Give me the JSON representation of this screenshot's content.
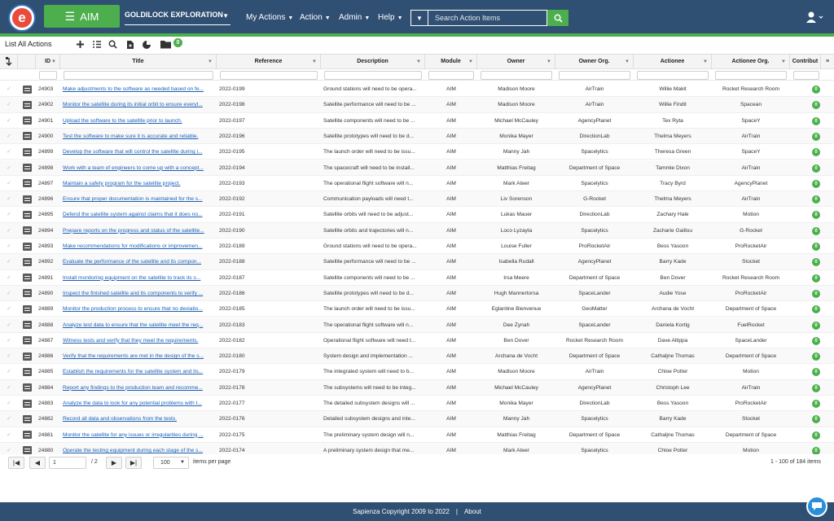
{
  "header": {
    "logo_letter": "e",
    "app_button": "AIM",
    "project": "GOLDILOCK EXPLORATION",
    "nav": [
      "My Actions",
      "Action",
      "Admin",
      "Help"
    ],
    "search_placeholder": "Search Action Items"
  },
  "toolbar": {
    "title": "List All Actions",
    "folder_badge": "0"
  },
  "columns": [
    "ID",
    "Title",
    "Reference",
    "Description",
    "Module",
    "Owner",
    "Owner Org.",
    "Actionee",
    "Actionee Org.",
    "Contribut"
  ],
  "rows": [
    {
      "id": "24903",
      "title": "Make adjustments to the software as needed based on fe...",
      "ref": "2022-0199",
      "desc": "Ground stations will need to be opera...",
      "module": "AIM",
      "owner": "Madison Moore",
      "owner_org": "AirTrain",
      "actionee": "Willie Makit",
      "actionee_org": "Rocket Research Room",
      "count": "0"
    },
    {
      "id": "24902",
      "title": "Monitor the satellite during its initial orbit to ensure everyt...",
      "ref": "2022-0198",
      "desc": "Satellite performance will need to be ...",
      "module": "AIM",
      "owner": "Madison Moore",
      "owner_org": "AirTrain",
      "actionee": "Willie Findit",
      "actionee_org": "Spacean",
      "count": "0"
    },
    {
      "id": "24901",
      "title": "Upload the software to the satellite prior to launch.",
      "ref": "2022-0197",
      "desc": "Satellite components will need to be ...",
      "module": "AIM",
      "owner": "Michael McCauley",
      "owner_org": "AgencyPlanet",
      "actionee": "Tex Ryta",
      "actionee_org": "SpaceY",
      "count": "0"
    },
    {
      "id": "24900",
      "title": "Test the software to make sure it is accurate and reliable.",
      "ref": "2022-0196",
      "desc": "Satellite prototypes will need to be d...",
      "module": "AIM",
      "owner": "Monika Mayer",
      "owner_org": "DirectionLab",
      "actionee": "Thelma Meyers",
      "actionee_org": "AirTrain",
      "count": "0"
    },
    {
      "id": "24899",
      "title": "Develop the software that will control the satellite during i...",
      "ref": "2022-0195",
      "desc": "The launch order will need to be issu...",
      "module": "AIM",
      "owner": "Manny Jah",
      "owner_org": "Spacelytics",
      "actionee": "Theresa Green",
      "actionee_org": "SpaceY",
      "count": "0"
    },
    {
      "id": "24898",
      "title": "Work with a team of engineers to come up with a concept...",
      "ref": "2022-0194",
      "desc": "The spacecraft will need to be install...",
      "module": "AIM",
      "owner": "Matthias Freitag",
      "owner_org": "Department of Space",
      "actionee": "Tammie Dixon",
      "actionee_org": "AirTrain",
      "count": "0"
    },
    {
      "id": "24897",
      "title": "Maintain a safety program for the satellite project.",
      "ref": "2022-0193",
      "desc": "The operational flight software will n...",
      "module": "AIM",
      "owner": "Mark Ateer",
      "owner_org": "Spacelytics",
      "actionee": "Tracy Byrd",
      "actionee_org": "AgencyPlanet",
      "count": "0"
    },
    {
      "id": "24896",
      "title": "Ensure that proper documentation is maintained for the s...",
      "ref": "2022-0192",
      "desc": "Communication payloads will need t...",
      "module": "AIM",
      "owner": "Liv Sorenson",
      "owner_org": "G-Rocket",
      "actionee": "Thelma Meyers",
      "actionee_org": "AirTrain",
      "count": "0"
    },
    {
      "id": "24895",
      "title": "Defend the satellite system against claims that it does no...",
      "ref": "2022-0191",
      "desc": "Satellite orbits will need to be adjust...",
      "module": "AIM",
      "owner": "Lukas Mauer",
      "owner_org": "DirectionLab",
      "actionee": "Zachary Hale",
      "actionee_org": "Motion",
      "count": "0"
    },
    {
      "id": "24894",
      "title": "Prepare reports on the progress and status of the satellite...",
      "ref": "2022-0190",
      "desc": "Satellite orbits and trajectories will n...",
      "module": "AIM",
      "owner": "Loco Lyzayta",
      "owner_org": "Spacelytics",
      "actionee": "Zacharie Gaillou",
      "actionee_org": "G-Rocket",
      "count": "0"
    },
    {
      "id": "24893",
      "title": "Make recommendations for modifications or improvemen...",
      "ref": "2022-0189",
      "desc": "Ground stations will need to be opera...",
      "module": "AIM",
      "owner": "Louise Fuller",
      "owner_org": "ProRocketAir",
      "actionee": "Bess Yasoon",
      "actionee_org": "ProRocketAir",
      "count": "0"
    },
    {
      "id": "24892",
      "title": "Evaluate the performance of the satellite and its compon...",
      "ref": "2022-0188",
      "desc": "Satellite performance will need to be ...",
      "module": "AIM",
      "owner": "Isabella Rudall",
      "owner_org": "AgencyPlanet",
      "actionee": "Barry Kade",
      "actionee_org": "Stocket",
      "count": "0"
    },
    {
      "id": "24891",
      "title": "Install monitoring equipment on the satellite to track its s...",
      "ref": "2022-0187",
      "desc": "Satellite components will need to be ...",
      "module": "AIM",
      "owner": "Irsa Meere",
      "owner_org": "Department of Space",
      "actionee": "Ben Dover",
      "actionee_org": "Rocket Research Room",
      "count": "0"
    },
    {
      "id": "24890",
      "title": "Inspect the finished satellite and its components to verify ...",
      "ref": "2022-0186",
      "desc": "Satellite prototypes will need to be d...",
      "module": "AIM",
      "owner": "Hugh Mannertorsa",
      "owner_org": "SpaceLander",
      "actionee": "Audie Yose",
      "actionee_org": "ProRocketAir",
      "count": "0"
    },
    {
      "id": "24889",
      "title": "Monitor the production process to ensure that no deviatio...",
      "ref": "2022-0185",
      "desc": "The launch order will need to be issu...",
      "module": "AIM",
      "owner": "Eglantine Bienvenue",
      "owner_org": "GeoMatter",
      "actionee": "Archana de Vocht",
      "actionee_org": "Department of Space",
      "count": "0"
    },
    {
      "id": "24888",
      "title": "Analyze test data to ensure that the satellite meet the req...",
      "ref": "2022-0183",
      "desc": "The operational flight software will n...",
      "module": "AIM",
      "owner": "Dee Zynah",
      "owner_org": "SpaceLander",
      "actionee": "Daniela Kortig",
      "actionee_org": "FuelRocket",
      "count": "0"
    },
    {
      "id": "24887",
      "title": "Witness tests and verify that they meet the requirements.",
      "ref": "2022-0182",
      "desc": "Operational flight software will need t...",
      "module": "AIM",
      "owner": "Ben Dover",
      "owner_org": "Rocket Research Room",
      "actionee": "Dave Allippa",
      "actionee_org": "SpaceLander",
      "count": "0"
    },
    {
      "id": "24886",
      "title": "Verify that the requirements are met in the design of the s...",
      "ref": "2022-0180",
      "desc": "System design and implementation ...",
      "module": "AIM",
      "owner": "Archana de Vocht",
      "owner_org": "Department of Space",
      "actionee": "Cathaljne Thomas",
      "actionee_org": "Department of Space",
      "count": "0"
    },
    {
      "id": "24885",
      "title": "Establish the requirements for the satellite system and its...",
      "ref": "2022-0179",
      "desc": "The integrated system will need to b...",
      "module": "AIM",
      "owner": "Madison Moore",
      "owner_org": "AirTrain",
      "actionee": "Chloe Potter",
      "actionee_org": "Motion",
      "count": "0"
    },
    {
      "id": "24884",
      "title": "Report any findings to the production team and recomme...",
      "ref": "2022-0178",
      "desc": "The subsystems will need to be integ...",
      "module": "AIM",
      "owner": "Michael McCauley",
      "owner_org": "AgencyPlanet",
      "actionee": "Christoph Lee",
      "actionee_org": "AirTrain",
      "count": "0"
    },
    {
      "id": "24883",
      "title": "Analyze the data to look for any potential problems with t...",
      "ref": "2022-0177",
      "desc": "The detailed subsystem designs will ...",
      "module": "AIM",
      "owner": "Monika Mayer",
      "owner_org": "DirectionLab",
      "actionee": "Bess Yasoon",
      "actionee_org": "ProRocketAir",
      "count": "0"
    },
    {
      "id": "24882",
      "title": "Record all data and observations from the tests.",
      "ref": "2022-0176",
      "desc": "Detailed subsystem designs and inte...",
      "module": "AIM",
      "owner": "Manny Jah",
      "owner_org": "Spacelytics",
      "actionee": "Barry Kade",
      "actionee_org": "Stocket",
      "count": "0"
    },
    {
      "id": "24881",
      "title": "Monitor the satellite for any issues or irregularities during ...",
      "ref": "2022-0175",
      "desc": "The preliminary system design will n...",
      "module": "AIM",
      "owner": "Matthias Freitag",
      "owner_org": "Department of Space",
      "actionee": "Cathaljne Thomas",
      "actionee_org": "Department of Space",
      "count": "0"
    },
    {
      "id": "24880",
      "title": "Operate the testing equipment during each stage of the s...",
      "ref": "2022-0174",
      "desc": "A preliminary system design that me...",
      "module": "AIM",
      "owner": "Mark Ateer",
      "owner_org": "Spacelytics",
      "actionee": "Chloe Potter",
      "actionee_org": "Motion",
      "count": "0"
    }
  ],
  "pager": {
    "page": "1",
    "of_pages": "/ 2",
    "page_size": "100",
    "per_page_label": "items per page",
    "summary": "1 - 100 of 184 items"
  },
  "footer": {
    "copyright": "Sapienza Copyright 2009 to 2022",
    "separator": "|",
    "about": "About"
  },
  "colors": {
    "header": "#2f4f73",
    "accent": "#4cae4c",
    "link": "#1a5fb4"
  }
}
